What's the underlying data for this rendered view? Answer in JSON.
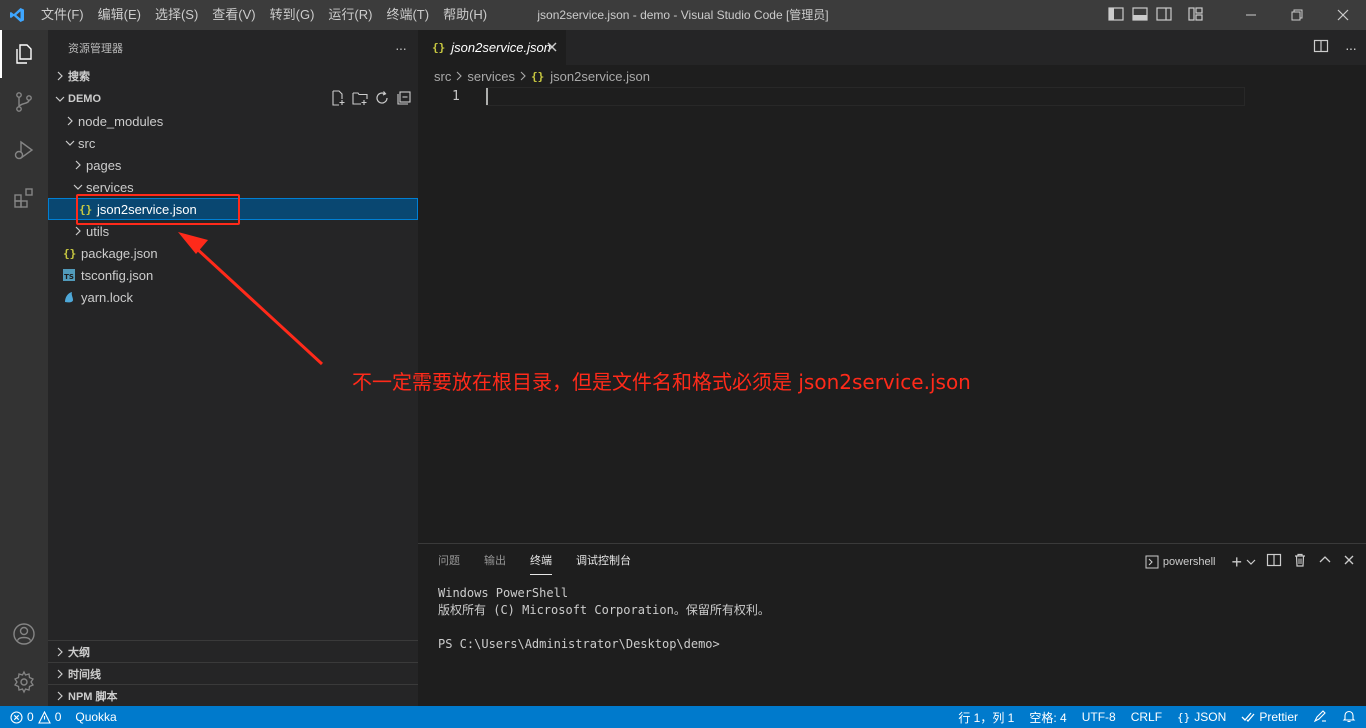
{
  "titlebar": {
    "menus": [
      "文件(F)",
      "编辑(E)",
      "选择(S)",
      "查看(V)",
      "转到(G)",
      "运行(R)",
      "终端(T)",
      "帮助(H)"
    ],
    "title": "json2service.json - demo - Visual Studio Code [管理员]"
  },
  "sidebar": {
    "header": "资源管理器",
    "more": "···",
    "search_section": "搜索",
    "workspace": "DEMO",
    "tree": [
      {
        "label": "node_modules",
        "kind": "folder",
        "expanded": false
      },
      {
        "label": "src",
        "kind": "folder",
        "expanded": true
      },
      {
        "label": "pages",
        "kind": "folder",
        "expanded": false
      },
      {
        "label": "services",
        "kind": "folder",
        "expanded": true
      },
      {
        "label": "json2service.json",
        "kind": "json",
        "selected": true
      },
      {
        "label": "utils",
        "kind": "folder",
        "expanded": false
      },
      {
        "label": "package.json",
        "kind": "json"
      },
      {
        "label": "tsconfig.json",
        "kind": "ts"
      },
      {
        "label": "yarn.lock",
        "kind": "yarn"
      }
    ],
    "bottom_sections": [
      "大纲",
      "时间线",
      "NPM 脚本"
    ]
  },
  "editor": {
    "tab_label": "json2service.json",
    "tab_icon": "{}",
    "breadcrumb": [
      "src",
      "services",
      "json2service.json"
    ],
    "line_number": "1"
  },
  "annotation": {
    "text": "不一定需要放在根目录，但是文件名和格式必须是 json2service.json",
    "color": "#ff2a1a"
  },
  "panel": {
    "tabs": [
      "问题",
      "输出",
      "终端",
      "调试控制台"
    ],
    "active_tab": "终端",
    "shell": "powershell",
    "add": "+",
    "terminal_lines": [
      "Windows PowerShell",
      "版权所有 (C) Microsoft Corporation。保留所有权利。",
      "",
      "PS C:\\Users\\Administrator\\Desktop\\demo>"
    ]
  },
  "statusbar": {
    "errors": "0",
    "warnings": "0",
    "quokka": "Quokka",
    "position": "行 1，列 1",
    "spaces": "空格: 4",
    "encoding": "UTF-8",
    "eol": "CRLF",
    "language": "JSON",
    "language_icon": "{}",
    "prettier": "Prettier"
  },
  "colors": {
    "accent": "#007acc",
    "selection": "#094771",
    "json_icon": "#cbcb41",
    "ts_icon": "#519aba"
  }
}
